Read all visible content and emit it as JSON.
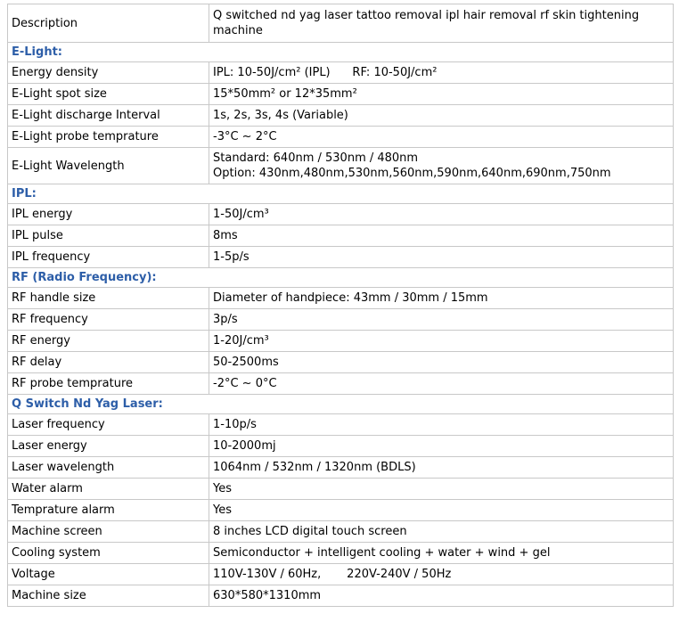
{
  "header": {
    "label": "Description",
    "value": "Q switched nd yag laser tattoo removal ipl hair removal rf skin tightening machine"
  },
  "sections": {
    "elight": {
      "title": "E-Light:",
      "rows": [
        {
          "label": "Energy density",
          "value": "IPL: 10-50J/cm² (IPL)      RF: 10-50J/cm²"
        },
        {
          "label": "E-Light spot size",
          "value": "15*50mm² or 12*35mm²"
        },
        {
          "label": "E-Light discharge Interval",
          "value": "1s, 2s, 3s, 4s (Variable)"
        },
        {
          "label": "E-Light probe temprature",
          "value": "-3°C ~ 2°C"
        }
      ],
      "wavelength": {
        "label": "E-Light Wavelength",
        "line1": "Standard: 640nm / 530nm / 480nm",
        "line2": "Option: 430nm,480nm,530nm,560nm,590nm,640nm,690nm,750nm"
      }
    },
    "ipl": {
      "title": "IPL:",
      "rows": [
        {
          "label": "IPL energy",
          "value": "1-50J/cm³"
        },
        {
          "label": "IPL pulse",
          "value": "8ms"
        },
        {
          "label": "IPL frequency",
          "value": "1-5p/s"
        }
      ]
    },
    "rf": {
      "title": "RF (Radio Frequency):",
      "rows": [
        {
          "label": "RF handle size",
          "value": "Diameter of handpiece: 43mm / 30mm / 15mm"
        },
        {
          "label": "RF frequency",
          "value": "3p/s"
        },
        {
          "label": "RF energy",
          "value": "1-20J/cm³"
        },
        {
          "label": "RF delay",
          "value": "50-2500ms"
        },
        {
          "label": "RF probe temprature",
          "value": "-2°C ~ 0°C"
        }
      ]
    },
    "laser": {
      "title": "Q Switch Nd Yag Laser:",
      "rows": [
        {
          "label": "Laser frequency",
          "value": "1-10p/s"
        },
        {
          "label": "Laser energy",
          "value": "10-2000mj"
        },
        {
          "label": "Laser wavelength",
          "value": "1064nm / 532nm / 1320nm (BDLS)"
        },
        {
          "label": "Water alarm",
          "value": "Yes"
        },
        {
          "label": "Temprature alarm",
          "value": "Yes"
        },
        {
          "label": "Machine screen",
          "value": "8 inches LCD digital touch screen"
        },
        {
          "label": "Cooling system",
          "value": "Semiconductor + intelligent cooling + water + wind + gel"
        },
        {
          "label": "Voltage",
          "value": "110V-130V / 60Hz,       220V-240V / 50Hz"
        },
        {
          "label": "Machine size",
          "value": "630*580*1310mm"
        }
      ]
    }
  }
}
